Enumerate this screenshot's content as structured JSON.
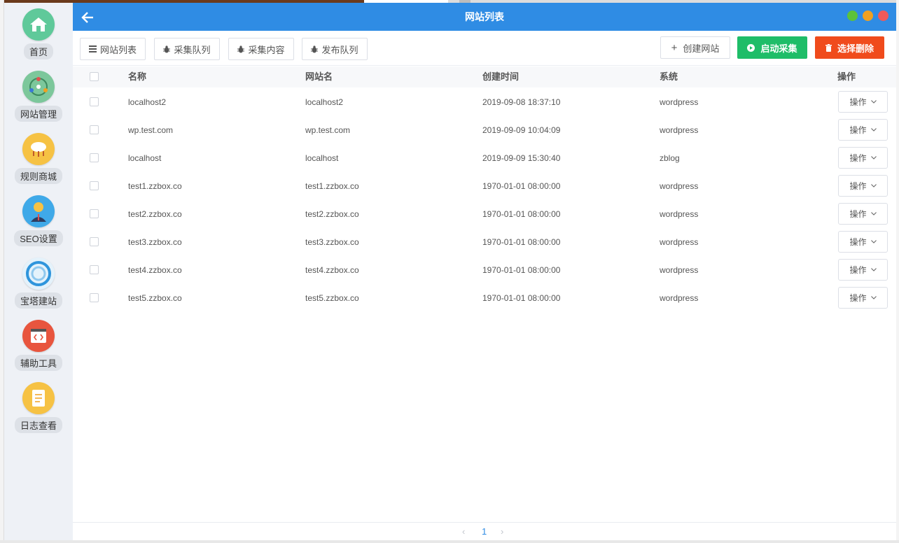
{
  "window": {
    "title": "网站列表"
  },
  "dock": [
    {
      "key": "home",
      "label": "首页"
    },
    {
      "key": "sites",
      "label": "网站管理"
    },
    {
      "key": "rules",
      "label": "规则商城"
    },
    {
      "key": "seo",
      "label": "SEO设置"
    },
    {
      "key": "bt",
      "label": "宝塔建站"
    },
    {
      "key": "tools",
      "label": "辅助工具"
    },
    {
      "key": "logs",
      "label": "日志查看"
    }
  ],
  "toolbar": {
    "tabs": [
      "网站列表",
      "采集队列",
      "采集内容",
      "发布队列"
    ],
    "create_label": "创建网站",
    "start_label": "启动采集",
    "delete_label": "选择删除"
  },
  "table": {
    "columns": [
      "名称",
      "网站名",
      "创建时间",
      "系统",
      "操作"
    ],
    "op_label": "操作",
    "rows": [
      {
        "name": "localhost2",
        "site": "localhost2",
        "created": "2019-09-08 18:37:10",
        "system": "wordpress"
      },
      {
        "name": "wp.test.com",
        "site": "wp.test.com",
        "created": "2019-09-09 10:04:09",
        "system": "wordpress"
      },
      {
        "name": "localhost",
        "site": "localhost",
        "created": "2019-09-09 15:30:40",
        "system": "zblog"
      },
      {
        "name": "test1.zzbox.co",
        "site": "test1.zzbox.co",
        "created": "1970-01-01 08:00:00",
        "system": "wordpress"
      },
      {
        "name": "test2.zzbox.co",
        "site": "test2.zzbox.co",
        "created": "1970-01-01 08:00:00",
        "system": "wordpress"
      },
      {
        "name": "test3.zzbox.co",
        "site": "test3.zzbox.co",
        "created": "1970-01-01 08:00:00",
        "system": "wordpress"
      },
      {
        "name": "test4.zzbox.co",
        "site": "test4.zzbox.co",
        "created": "1970-01-01 08:00:00",
        "system": "wordpress"
      },
      {
        "name": "test5.zzbox.co",
        "site": "test5.zzbox.co",
        "created": "1970-01-01 08:00:00",
        "system": "wordpress"
      }
    ]
  },
  "pagination": {
    "current": "1"
  },
  "colors": {
    "titlebar": "#2f8ce4",
    "start": "#1ebd68",
    "delete": "#f04b1c"
  }
}
